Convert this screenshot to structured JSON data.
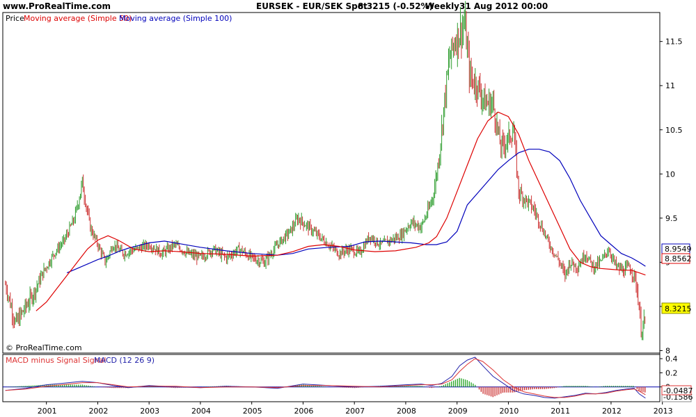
{
  "header": {
    "site": "www.ProRealTime.com",
    "title": "EURSEK - EUR/SEK Spot",
    "quote": "8.3215 (-0.52%)",
    "period": "Weekly",
    "datetime": "31 Aug 2012 00:00"
  },
  "watermark": "© ProRealTime.com",
  "colors": {
    "price": "#2e9d2e",
    "price_down": "#cc3333",
    "ma50": "#dd0000",
    "ma100": "#0000bb",
    "macd_line": "#2222aa",
    "macd_signal": "#dd3333",
    "histogram_pos": "#33aa33",
    "histogram_neg": "#cc3333",
    "last_price_badge": "#ffff00"
  },
  "legend_main": {
    "price": "Price",
    "ma50": "Moving average (Simple 50)",
    "ma100": "Moving average (Simple 100)"
  },
  "legend_macd": {
    "hist": "MACD minus Signal Signal",
    "macd": "MACD (12 26 9)"
  },
  "badges": {
    "ma100": "8.9549",
    "ma50": "8.8562",
    "price": "8.3215",
    "macd": "-0.0487",
    "macd_hidden": "-0.1586"
  },
  "chart_data": [
    {
      "type": "line",
      "title": "EURSEK - EUR/SEK Spot",
      "y_ticks": [
        "8",
        "8.5",
        "9",
        "9.5",
        "10",
        "10.5",
        "11",
        "11.5"
      ],
      "x_ticks": [
        "2001",
        "2002",
        "2003",
        "2004",
        "2005",
        "2006",
        "2007",
        "2008",
        "2009",
        "2010",
        "2011",
        "2012",
        "2013"
      ],
      "ylim": [
        7.98,
        11.82
      ],
      "xlim": [
        2000.15,
        2012.95
      ],
      "grid": false,
      "series": [
        {
          "name": "Price",
          "x": [
            2000.2,
            2000.4,
            2000.55,
            2000.75,
            2000.95,
            2001.15,
            2001.35,
            2001.55,
            2001.7,
            2001.85,
            2002.0,
            2002.15,
            2002.3,
            2002.5,
            2002.75,
            2003.0,
            2003.25,
            2003.5,
            2003.75,
            2004.0,
            2004.25,
            2004.5,
            2004.75,
            2005.0,
            2005.25,
            2005.5,
            2005.75,
            2005.9,
            2006.1,
            2006.3,
            2006.5,
            2006.7,
            2006.9,
            2007.1,
            2007.3,
            2007.5,
            2007.7,
            2007.9,
            2008.1,
            2008.3,
            2008.45,
            2008.55,
            2008.65,
            2008.75,
            2008.85,
            2008.95,
            2009.05,
            2009.15,
            2009.25,
            2009.4,
            2009.55,
            2009.7,
            2009.85,
            2010.0,
            2010.1,
            2010.2,
            2010.35,
            2010.5,
            2010.65,
            2010.8,
            2011.0,
            2011.1,
            2011.2,
            2011.35,
            2011.5,
            2011.65,
            2011.8,
            2011.95,
            2012.1,
            2012.25,
            2012.35,
            2012.45,
            2012.52,
            2012.58,
            2012.67
          ],
          "values": [
            8.75,
            8.3,
            8.45,
            8.65,
            8.9,
            9.1,
            9.25,
            9.5,
            9.9,
            9.4,
            9.2,
            9.0,
            9.2,
            9.1,
            9.15,
            9.2,
            9.1,
            9.2,
            9.1,
            9.05,
            9.15,
            9.05,
            9.15,
            9.05,
            9.0,
            9.2,
            9.35,
            9.5,
            9.4,
            9.3,
            9.2,
            9.1,
            9.15,
            9.1,
            9.3,
            9.2,
            9.25,
            9.3,
            9.45,
            9.4,
            9.6,
            9.8,
            10.2,
            10.8,
            11.3,
            11.5,
            11.6,
            11.7,
            11.1,
            11.0,
            10.8,
            10.8,
            10.3,
            10.4,
            10.5,
            9.8,
            9.7,
            9.6,
            9.4,
            9.2,
            9.0,
            8.85,
            9.0,
            8.95,
            9.1,
            8.95,
            9.0,
            9.15,
            8.95,
            8.9,
            8.95,
            8.85,
            8.65,
            8.25,
            8.32
          ]
        },
        {
          "name": "Moving average (Simple 50)",
          "x": [
            2000.2,
            2000.4,
            2000.6,
            2000.8,
            2001.0,
            2001.2,
            2001.4,
            2001.6,
            2001.8,
            2002.0,
            2002.2,
            2002.4,
            2002.7,
            2003.0,
            2003.3,
            2003.6,
            2004.0,
            2004.5,
            2005.0,
            2005.5,
            2005.8,
            2006.1,
            2006.4,
            2006.7,
            2007.0,
            2007.4,
            2007.8,
            2008.2,
            2008.45,
            2008.6,
            2008.8,
            2009.0,
            2009.2,
            2009.4,
            2009.6,
            2009.8,
            2010.0,
            2010.2,
            2010.4,
            2010.6,
            2010.8,
            2011.0,
            2011.2,
            2011.4,
            2011.6,
            2011.8,
            2012.0,
            2012.2,
            2012.4,
            2012.55,
            2012.67
          ],
          "values": [
            null,
            null,
            null,
            8.45,
            8.55,
            8.7,
            8.85,
            9.0,
            9.15,
            9.25,
            9.3,
            9.25,
            9.15,
            9.12,
            9.13,
            9.12,
            9.1,
            9.09,
            9.07,
            9.08,
            9.12,
            9.18,
            9.2,
            9.18,
            9.14,
            9.12,
            9.13,
            9.17,
            9.22,
            9.29,
            9.5,
            9.8,
            10.1,
            10.4,
            10.6,
            10.7,
            10.65,
            10.45,
            10.15,
            9.9,
            9.65,
            9.4,
            9.15,
            9.0,
            8.95,
            8.93,
            8.92,
            8.91,
            8.91,
            8.88,
            8.856
          ]
        },
        {
          "name": "Moving average (Simple 100)",
          "x": [
            2001.4,
            2001.6,
            2001.8,
            2002.0,
            2002.2,
            2002.4,
            2002.6,
            2002.8,
            2003.0,
            2003.3,
            2003.6,
            2004.0,
            2004.5,
            2005.0,
            2005.5,
            2005.8,
            2006.1,
            2006.5,
            2006.9,
            2007.2,
            2007.5,
            2007.8,
            2008.1,
            2008.4,
            2008.6,
            2008.8,
            2009.0,
            2009.2,
            2009.5,
            2009.8,
            2010.0,
            2010.2,
            2010.4,
            2010.6,
            2010.8,
            2011.0,
            2011.2,
            2011.4,
            2011.6,
            2011.8,
            2012.0,
            2012.2,
            2012.4,
            2012.55,
            2012.67
          ],
          "values": [
            8.88,
            8.93,
            8.98,
            9.03,
            9.07,
            9.12,
            9.16,
            9.19,
            9.22,
            9.24,
            9.21,
            9.17,
            9.13,
            9.1,
            9.08,
            9.1,
            9.15,
            9.17,
            9.18,
            9.23,
            9.24,
            9.23,
            9.22,
            9.2,
            9.2,
            9.23,
            9.35,
            9.65,
            9.85,
            10.05,
            10.15,
            10.24,
            10.28,
            10.28,
            10.25,
            10.15,
            9.95,
            9.7,
            9.5,
            9.3,
            9.2,
            9.1,
            9.05,
            9.0,
            8.955
          ]
        }
      ]
    },
    {
      "type": "bar",
      "title": "MACD (12 26 9)",
      "y_ticks": [
        "0.4",
        "0.2",
        "0"
      ],
      "ylim": [
        -0.2,
        0.45
      ],
      "series": [
        {
          "name": "MACD (12 26 9)",
          "x": [
            2000.2,
            2000.6,
            2001.0,
            2001.3,
            2001.7,
            2002.0,
            2002.3,
            2002.6,
            2003.0,
            2003.5,
            2004.0,
            2004.5,
            2005.0,
            2005.5,
            2006.0,
            2006.5,
            2007.0,
            2007.5,
            2008.0,
            2008.3,
            2008.5,
            2008.7,
            2008.9,
            2009.05,
            2009.2,
            2009.35,
            2009.5,
            2009.7,
            2009.9,
            2010.1,
            2010.3,
            2010.5,
            2010.7,
            2010.9,
            2011.1,
            2011.3,
            2011.5,
            2011.7,
            2011.9,
            2012.1,
            2012.3,
            2012.45,
            2012.55,
            2012.67
          ],
          "values": [
            -0.05,
            -0.02,
            0.03,
            0.05,
            0.08,
            0.06,
            0.02,
            -0.01,
            0.02,
            0.0,
            -0.01,
            0.01,
            0.0,
            -0.02,
            0.04,
            0.02,
            0.0,
            0.01,
            0.03,
            0.04,
            0.02,
            0.05,
            0.15,
            0.3,
            0.38,
            0.42,
            0.3,
            0.15,
            0.05,
            -0.05,
            -0.1,
            -0.12,
            -0.15,
            -0.16,
            -0.14,
            -0.12,
            -0.09,
            -0.1,
            -0.08,
            -0.05,
            -0.03,
            -0.02,
            -0.1,
            -0.16
          ]
        },
        {
          "name": "MACD minus Signal Signal",
          "x": [
            2000.2,
            2000.6,
            2001.0,
            2001.3,
            2001.7,
            2002.0,
            2002.3,
            2002.6,
            2003.0,
            2003.5,
            2004.0,
            2004.5,
            2005.0,
            2005.5,
            2006.0,
            2006.5,
            2007.0,
            2007.5,
            2008.0,
            2008.3,
            2008.5,
            2008.7,
            2008.9,
            2009.05,
            2009.2,
            2009.35,
            2009.5,
            2009.7,
            2009.9,
            2010.1,
            2010.3,
            2010.5,
            2010.7,
            2010.9,
            2011.1,
            2011.3,
            2011.5,
            2011.7,
            2011.9,
            2012.1,
            2012.3,
            2012.45,
            2012.55,
            2012.67
          ],
          "values": [
            -0.05,
            -0.03,
            0.01,
            0.03,
            0.06,
            0.06,
            0.03,
            0.0,
            0.01,
            0.01,
            -0.01,
            0.0,
            0.0,
            -0.01,
            0.02,
            0.02,
            0.01,
            0.0,
            0.02,
            0.03,
            0.03,
            0.04,
            0.1,
            0.22,
            0.32,
            0.4,
            0.36,
            0.24,
            0.1,
            0.0,
            -0.07,
            -0.1,
            -0.13,
            -0.15,
            -0.15,
            -0.13,
            -0.1,
            -0.1,
            -0.09,
            -0.06,
            -0.04,
            -0.03,
            -0.06,
            -0.11
          ]
        }
      ]
    }
  ]
}
